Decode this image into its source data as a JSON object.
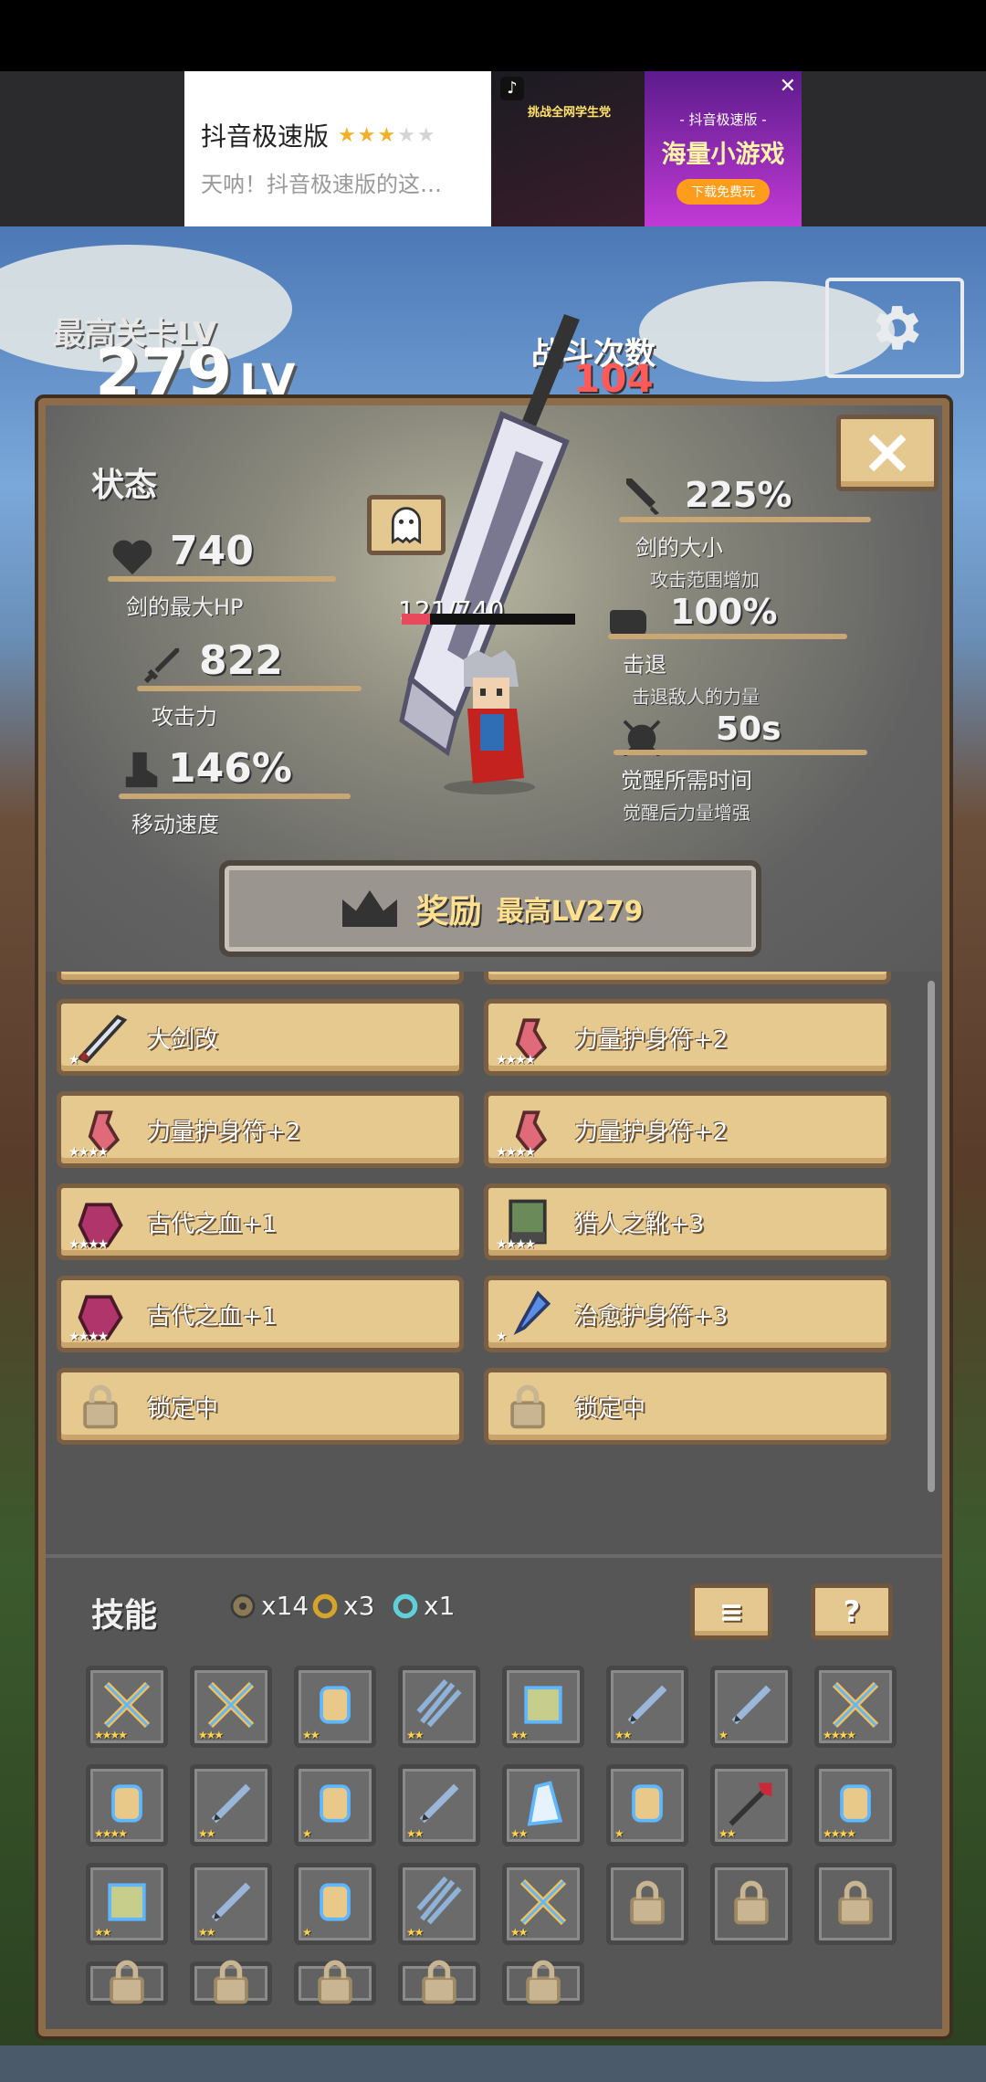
{
  "ad": {
    "app_name": "抖音极速版",
    "stars_on": "★★★",
    "stars_off": "★★",
    "subtitle": "天呐！抖音极速版的这…",
    "promo_caption": "挑战全网学生党",
    "right_small": "- 抖音极速版 -",
    "right_big": "海量小游戏",
    "right_button": "下载免费玩",
    "close": "✕"
  },
  "hud": {
    "max_stage_label": "最高关卡LV",
    "max_stage_value": "279",
    "max_stage_unit": "LV",
    "battle_label": "战斗次数",
    "battle_value": "104"
  },
  "status": {
    "title": "状态",
    "hp_value": "740",
    "hp_label": "剑的最大HP",
    "atk_value": "822",
    "atk_label": "攻击力",
    "speed_value": "146%",
    "speed_label": "移动速度",
    "size_value": "225%",
    "size_label": "剑的大小",
    "size_sub": "攻击范围增加",
    "knockback_value": "100%",
    "knockback_label": "击退",
    "knockback_sub": "击退敌人的力量",
    "awaken_value": "50s",
    "awaken_label": "觉醒所需时间",
    "awaken_sub": "觉醒后力量增强",
    "current_hp_text": "121/740",
    "hp_fraction": 0.163
  },
  "reward": {
    "label": "奖励",
    "level": "最高LV279"
  },
  "equipment": [
    {
      "label": "大剑改",
      "icon": "greatsword-icon",
      "stars": "★"
    },
    {
      "label": "力量护身符+2",
      "icon": "strength-charm-icon",
      "stars": "★★★★"
    },
    {
      "label": "力量护身符+2",
      "icon": "strength-charm-icon",
      "stars": "★★★★"
    },
    {
      "label": "力量护身符+2",
      "icon": "strength-charm-icon",
      "stars": "★★★★"
    },
    {
      "label": "古代之血+1",
      "icon": "ancient-blood-icon",
      "stars": "★★★★"
    },
    {
      "label": "猎人之靴+3",
      "icon": "hunter-boots-icon",
      "stars": "★★★★"
    },
    {
      "label": "古代之血+1",
      "icon": "ancient-blood-icon",
      "stars": "★★★★"
    },
    {
      "label": "治愈护身符+3",
      "icon": "healing-charm-icon",
      "stars": "★"
    },
    {
      "label": "锁定中",
      "icon": "lock-icon",
      "stars": ""
    },
    {
      "label": "锁定中",
      "icon": "lock-icon",
      "stars": ""
    }
  ],
  "skills": {
    "title": "技能",
    "currency": [
      {
        "icon": "gear-coin-icon",
        "amount": "x14"
      },
      {
        "icon": "gold-ring-icon",
        "amount": "x3"
      },
      {
        "icon": "cyan-ring-icon",
        "amount": "x1"
      }
    ],
    "menu_icon": "≡",
    "help_label": "?",
    "grid": [
      {
        "icon": "crossed-swords-icon",
        "stars": "★★★★",
        "locked": false
      },
      {
        "icon": "crossed-swords-icon",
        "stars": "★★★",
        "locked": false
      },
      {
        "icon": "scroll-icon",
        "stars": "★★",
        "locked": false
      },
      {
        "icon": "triple-daggers-icon",
        "stars": "★★",
        "locked": false
      },
      {
        "icon": "tome-icon",
        "stars": "★★",
        "locked": false
      },
      {
        "icon": "dagger-icon",
        "stars": "★★",
        "locked": false
      },
      {
        "icon": "dagger-icon",
        "stars": "★",
        "locked": false
      },
      {
        "icon": "crossed-swords-icon",
        "stars": "★★★★",
        "locked": false
      },
      {
        "icon": "scroll-icon",
        "stars": "★★★★",
        "locked": false
      },
      {
        "icon": "dagger-icon",
        "stars": "★★",
        "locked": false
      },
      {
        "icon": "scroll-icon",
        "stars": "★",
        "locked": false
      },
      {
        "icon": "dagger-icon",
        "stars": "★★",
        "locked": false
      },
      {
        "icon": "ice-shard-icon",
        "stars": "★★",
        "locked": false
      },
      {
        "icon": "scroll-icon",
        "stars": "★",
        "locked": false
      },
      {
        "icon": "red-spear-icon",
        "stars": "★★",
        "locked": false
      },
      {
        "icon": "scroll-icon",
        "stars": "★★★★",
        "locked": false
      },
      {
        "icon": "tome-icon",
        "stars": "★★",
        "locked": false
      },
      {
        "icon": "dagger-icon",
        "stars": "★★",
        "locked": false
      },
      {
        "icon": "scroll-icon",
        "stars": "★",
        "locked": false
      },
      {
        "icon": "triple-daggers-icon",
        "stars": "★★",
        "locked": false
      },
      {
        "icon": "crossed-swords-icon",
        "stars": "★★",
        "locked": false
      },
      {
        "icon": "lock-icon",
        "stars": "",
        "locked": true
      },
      {
        "icon": "lock-icon",
        "stars": "",
        "locked": true
      },
      {
        "icon": "lock-icon",
        "stars": "",
        "locked": true
      },
      {
        "icon": "lock-icon",
        "stars": "",
        "locked": true
      },
      {
        "icon": "lock-icon",
        "stars": "",
        "locked": true
      },
      {
        "icon": "lock-icon",
        "stars": "",
        "locked": true
      },
      {
        "icon": "lock-icon",
        "stars": "",
        "locked": true
      },
      {
        "icon": "lock-icon",
        "stars": "",
        "locked": true
      }
    ]
  },
  "colors": {
    "gold_button": "#e5c88f",
    "button_border": "#6e5640",
    "panel_bg": "#565656",
    "panel_frame": "#8d6d49",
    "battle_count": "#ff5a5a",
    "hp_bar_fill": "#e74a5c",
    "reward_text": "#ffe08e"
  }
}
